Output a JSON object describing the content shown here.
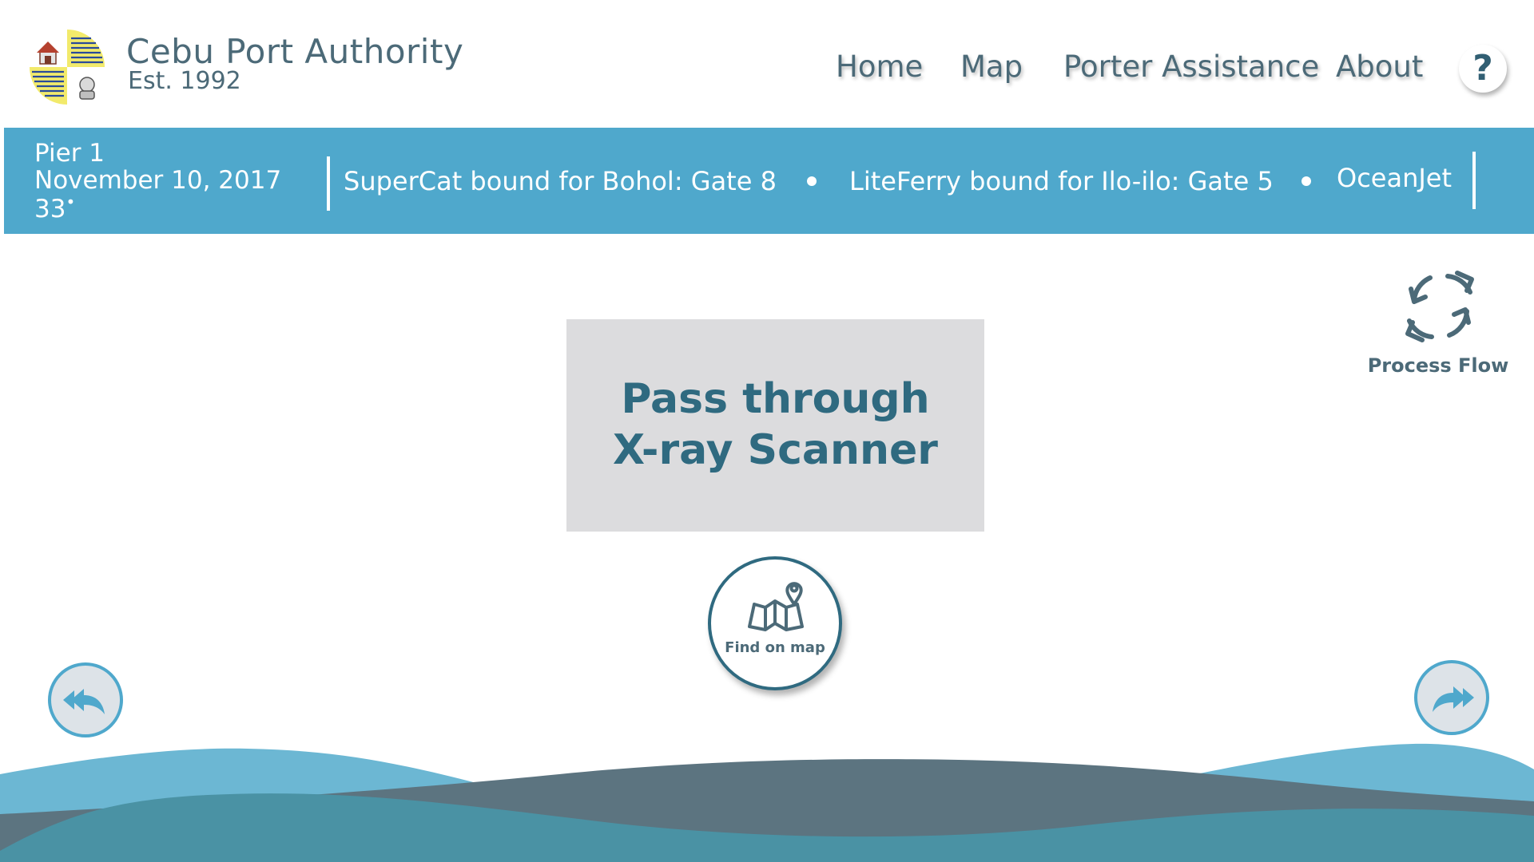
{
  "header": {
    "title": "Cebu Port Authority",
    "established": "Est. 1992",
    "nav": {
      "home": "Home",
      "map": "Map",
      "porter": "Porter Assistance",
      "about": "About"
    },
    "help_label": "?"
  },
  "info_bar": {
    "pier": "Pier 1",
    "date": "November 10, 2017",
    "temperature": "33",
    "degree_symbol": "•",
    "ticker": [
      "SuperCat bound for Bohol: Gate 8",
      "LiteFerry bound for Ilo-ilo: Gate 5",
      "OceanJet"
    ]
  },
  "process_flow": {
    "label": "Process Flow",
    "icon": "refresh-arrows-icon"
  },
  "step": {
    "line1": "Pass through",
    "line2": "X-ray Scanner"
  },
  "find_map": {
    "label": "Find on map",
    "icon": "map-pin-icon"
  },
  "navigation": {
    "back_icon": "reply-all-icon",
    "forward_icon": "forward-all-icon"
  },
  "colors": {
    "accent_blue": "#4fa8cc",
    "dark_teal": "#2f6a80",
    "text_slate": "#4c6a78",
    "card_gray": "#dcdcde",
    "wave_light": "#6cb7d3",
    "wave_slate": "#5c7480",
    "wave_teal": "#4a92a4"
  }
}
